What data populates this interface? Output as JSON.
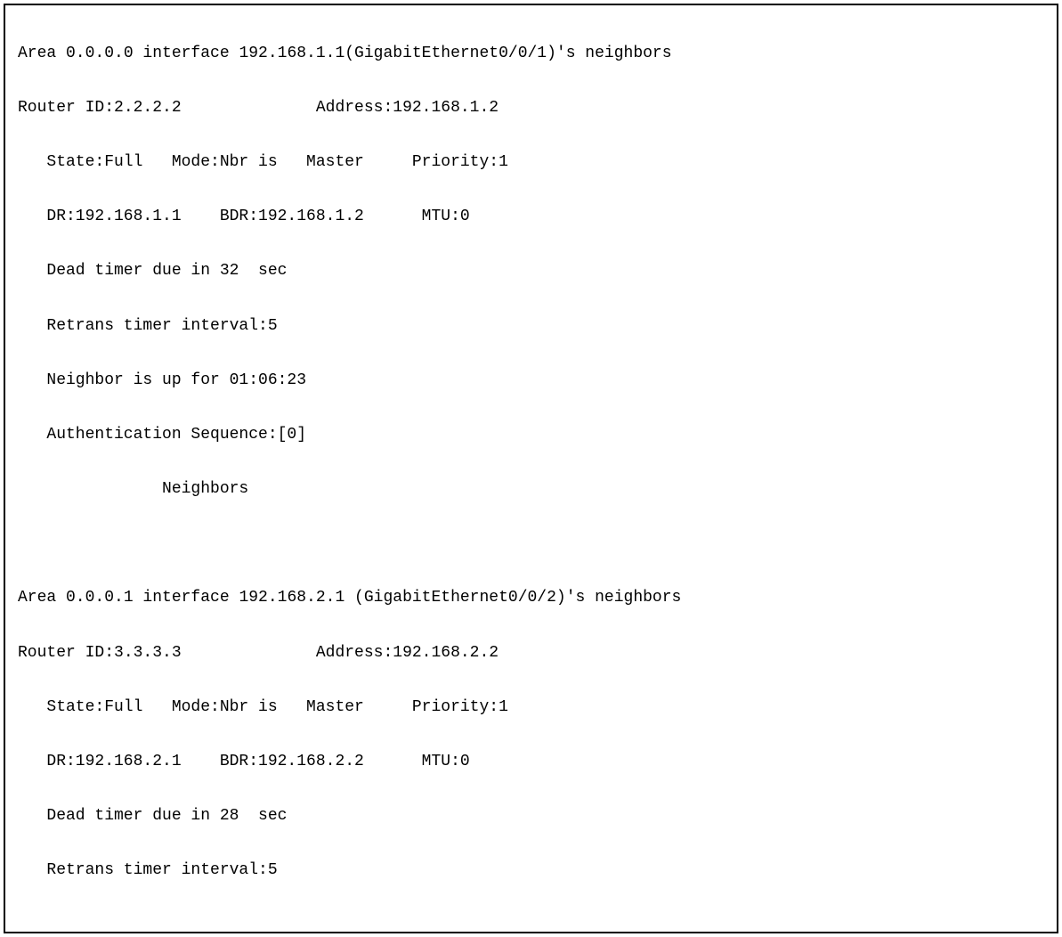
{
  "output": {
    "area1": {
      "header": "Area 0.0.0.0 interface 192.168.1.1(GigabitEthernet0/0/1)'s neighbors",
      "router_line": "Router ID:2.2.2.2              Address:192.168.1.2",
      "state_line": "State:Full   Mode:Nbr is   Master     Priority:1",
      "dr_line": "DR:192.168.1.1    BDR:192.168.1.2      MTU:0",
      "dead_timer": "Dead timer due in 32  sec",
      "retrans": "Retrans timer interval:5",
      "uptime": "Neighbor is up for 01:06:23",
      "auth": "Authentication Sequence:[0]",
      "neighbors_label": "Neighbors"
    },
    "area2": {
      "header": "Area 0.0.0.1 interface 192.168.2.1 (GigabitEthernet0/0/2)'s neighbors",
      "router_line": "Router ID:3.3.3.3              Address:192.168.2.2",
      "state_line": "State:Full   Mode:Nbr is   Master     Priority:1",
      "dr_line": "DR:192.168.2.1    BDR:192.168.2.2      MTU:0",
      "dead_timer": "Dead timer due in 28  sec",
      "retrans": "Retrans timer interval:5"
    }
  }
}
